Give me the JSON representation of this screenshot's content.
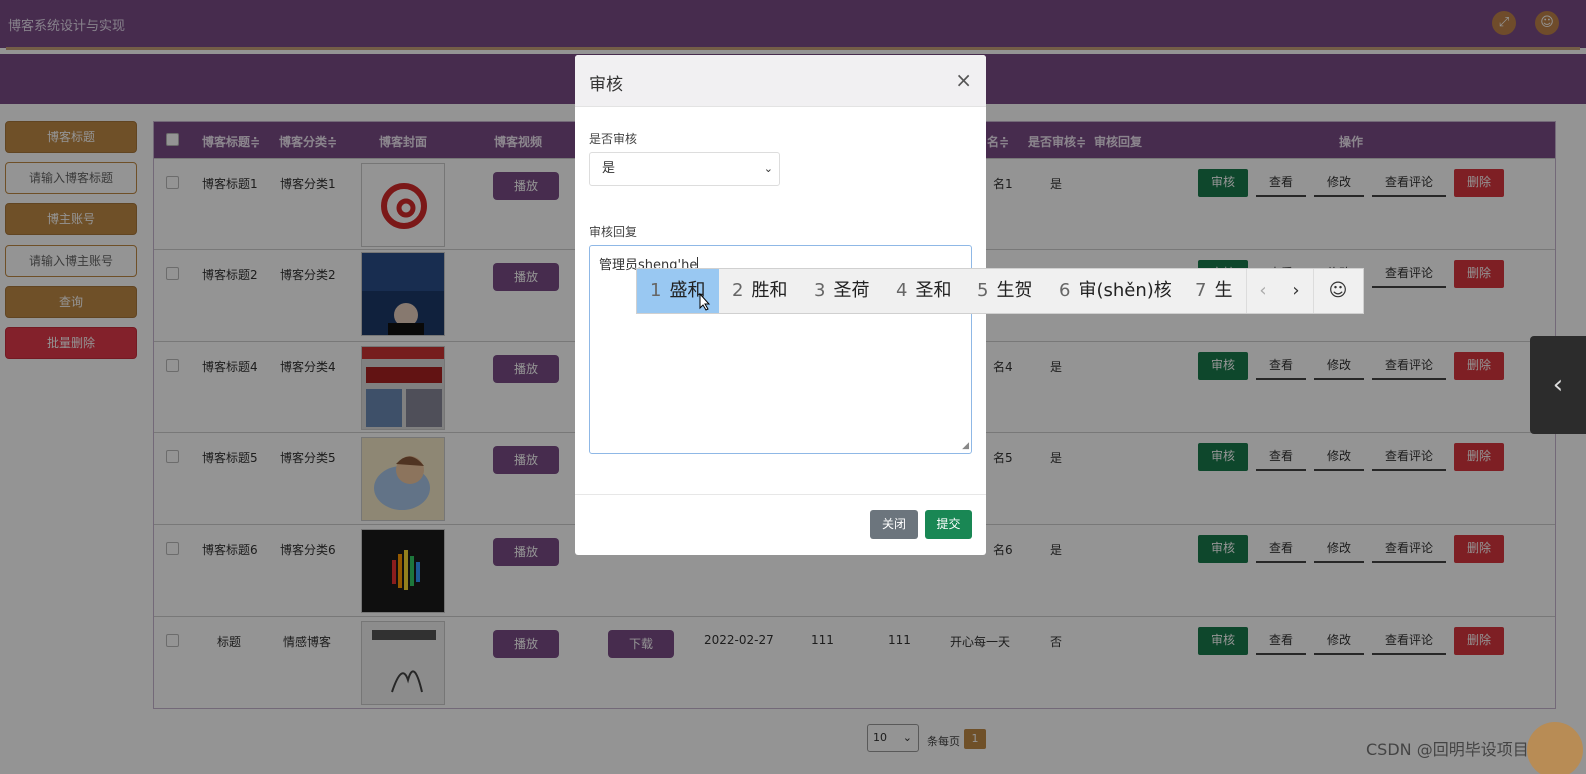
{
  "app": {
    "title": "博客系统设计与实现"
  },
  "sidebar": {
    "items": [
      {
        "label": "博客标题",
        "style": "gold"
      },
      {
        "label": "请输入博客标题",
        "style": "input"
      },
      {
        "label": "博主账号",
        "style": "gold"
      },
      {
        "label": "请输入博主账号",
        "style": "input"
      },
      {
        "label": "查询",
        "style": "gold"
      },
      {
        "label": "批量删除",
        "style": "red"
      }
    ]
  },
  "table": {
    "headers": [
      "博客标题",
      "博客分类",
      "博客封面",
      "博客视频",
      "名",
      "是否审核",
      "审核回复",
      "操作"
    ],
    "sort_marks": "≑",
    "rows": [
      {
        "title": "博客标题1",
        "category": "博客分类1",
        "cover": "red-logo",
        "video_btn": "播放",
        "name": "名1",
        "audited": "是"
      },
      {
        "title": "博客标题2",
        "category": "博客分类2",
        "cover": "news-photo",
        "video_btn": "播放",
        "name": "",
        "audited": ""
      },
      {
        "title": "博客标题4",
        "category": "博客分类4",
        "cover": "newspaper",
        "video_btn": "播放",
        "name": "名4",
        "audited": "是"
      },
      {
        "title": "博客标题5",
        "category": "博客分类5",
        "cover": "cartoon",
        "video_btn": "播放",
        "name": "名5",
        "audited": "是"
      },
      {
        "title": "博客标题6",
        "category": "博客分类6",
        "cover": "dark-wave",
        "video_btn": "播放",
        "name": "名6",
        "audited": "是"
      },
      {
        "title": "标题",
        "category": "情感博客",
        "cover": "book",
        "video_btn": "播放",
        "download_btn": "下载",
        "date": "2022-02-27",
        "v1": "111",
        "v2": "111",
        "name": "开心每一天",
        "audited": "否"
      }
    ],
    "actions": {
      "audit": "审核",
      "view": "查看",
      "edit": "修改",
      "view_comments": "查看评论",
      "delete": "删除"
    }
  },
  "pager": {
    "page_size": "10",
    "per_page_text": "条每页",
    "current_page": "1"
  },
  "modal": {
    "title": "审核",
    "close": "×",
    "audit_label": "是否审核",
    "audit_value": "是",
    "reply_label": "审核回复",
    "reply_value": "管理员sheng'he",
    "close_btn": "关闭",
    "submit_btn": "提交"
  },
  "ime": {
    "candidates": [
      {
        "num": "1",
        "text": "盛和"
      },
      {
        "num": "2",
        "text": "胜和"
      },
      {
        "num": "3",
        "text": "圣荷"
      },
      {
        "num": "4",
        "text": "圣和"
      },
      {
        "num": "5",
        "text": "生贺"
      },
      {
        "num": "6",
        "text": "审(shěn)核"
      },
      {
        "num": "7",
        "text": "生"
      }
    ],
    "prev": "‹",
    "next": "›",
    "emoji": "☺"
  },
  "watermark": "CSDN @回明毕设项目",
  "colors": {
    "primary": "#7a4d87",
    "gold": "#c08a45",
    "green": "#197a4d",
    "red": "#d9363e"
  }
}
